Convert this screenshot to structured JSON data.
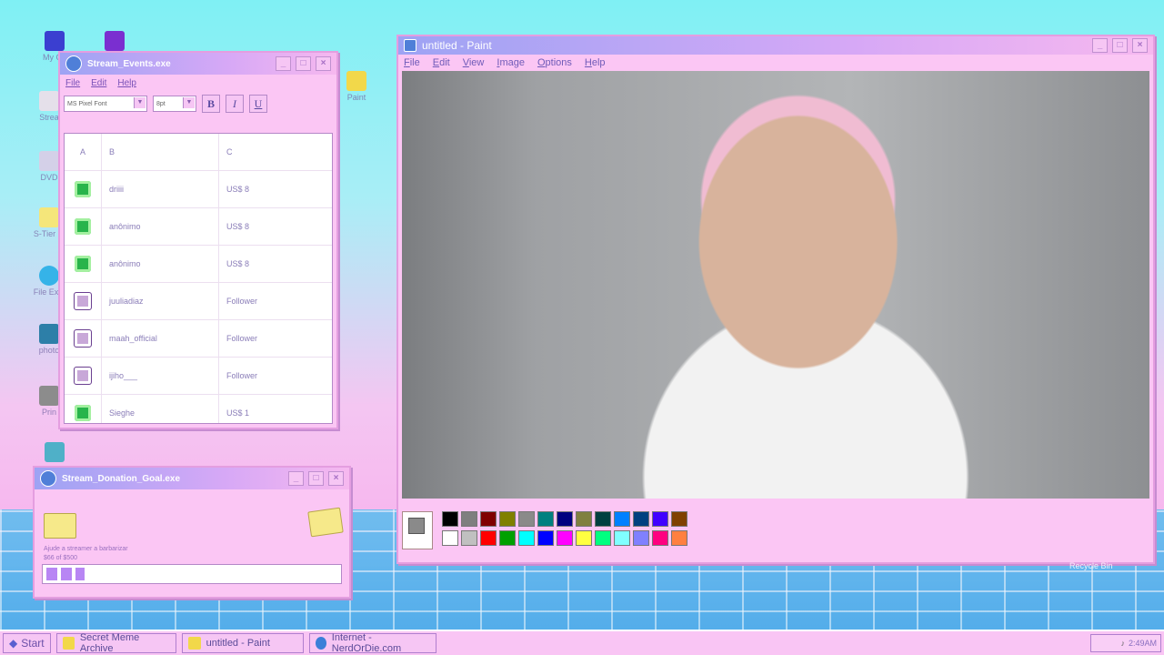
{
  "desktop": {
    "icons": [
      {
        "name": "my-computer-icon",
        "label": "My Co"
      },
      {
        "name": "network-icon",
        "label": ""
      },
      {
        "name": "folder-icon-1",
        "label": "Strea"
      },
      {
        "name": "disk-icon",
        "label": "DVD"
      },
      {
        "name": "folder-icon-2",
        "label": "S-Tier M"
      },
      {
        "name": "browser-icon",
        "label": "File Expl"
      },
      {
        "name": "photo-icon",
        "label": "photo"
      },
      {
        "name": "printer-icon",
        "label": "Prin"
      },
      {
        "name": "paint-shortcut-icon",
        "label": "Paint"
      }
    ],
    "recycle_bin_label": "Recycle Bin"
  },
  "events_window": {
    "title": "Stream_Events.exe",
    "menu": [
      "File",
      "Edit",
      "Help"
    ],
    "font_select": "MS Pixel Font",
    "size_select": "8pt",
    "bold": "B",
    "italic": "I",
    "underline": "U",
    "headers": {
      "a": "A",
      "b": "B",
      "c": "C"
    },
    "rows": [
      {
        "type": "money",
        "user": "driiii",
        "value": "US$ 8"
      },
      {
        "type": "money",
        "user": "anônimo",
        "value": "US$ 8"
      },
      {
        "type": "money",
        "user": "anônimo",
        "value": "US$ 8"
      },
      {
        "type": "follower",
        "user": "juuliadiaz",
        "value": "Follower"
      },
      {
        "type": "follower",
        "user": "maah_official",
        "value": "Follower"
      },
      {
        "type": "follower",
        "user": "ijiho___",
        "value": "Follower"
      },
      {
        "type": "money",
        "user": "Sieghe",
        "value": "US$ 1"
      }
    ]
  },
  "donation_window": {
    "title": "Stream_Donation_Goal.exe",
    "goal_text": "Ajude a streamer a barbarizar",
    "progress_text": "$66 of $500",
    "progress_fraction": 0.132
  },
  "paint_window": {
    "title": "untitled - Paint",
    "menu": [
      "File",
      "Edit",
      "View",
      "Image",
      "Options",
      "Help"
    ],
    "palette_top": [
      "#000000",
      "#7f7f7f",
      "#800000",
      "#808000",
      "#8a8a8a",
      "#008080",
      "#000080",
      "#808040",
      "#004040",
      "#0080ff",
      "#004080",
      "#4000ff",
      "#804000"
    ],
    "palette_bottom": [
      "#ffffff",
      "#c0c0c0",
      "#ff0000",
      "#00a000",
      "#00ffff",
      "#0000ff",
      "#ff00ff",
      "#ffff40",
      "#00ff80",
      "#80ffff",
      "#8080ff",
      "#ff0080",
      "#ff8040"
    ],
    "current_fg": "#8a8a8a"
  },
  "taskbar": {
    "start_label": "Start",
    "tasks": [
      {
        "label": "Secret Meme Archive",
        "icon": "folder-icon"
      },
      {
        "label": "untitled - Paint",
        "icon": "paint-icon"
      },
      {
        "label": "Internet - NerdOrDie.com",
        "icon": "internet-icon"
      }
    ],
    "clock": "2:49AM"
  },
  "colors": {
    "accent_purple": "#9da3f4",
    "window_pink": "#fbc6f4",
    "text_purple": "#7a52b8"
  }
}
